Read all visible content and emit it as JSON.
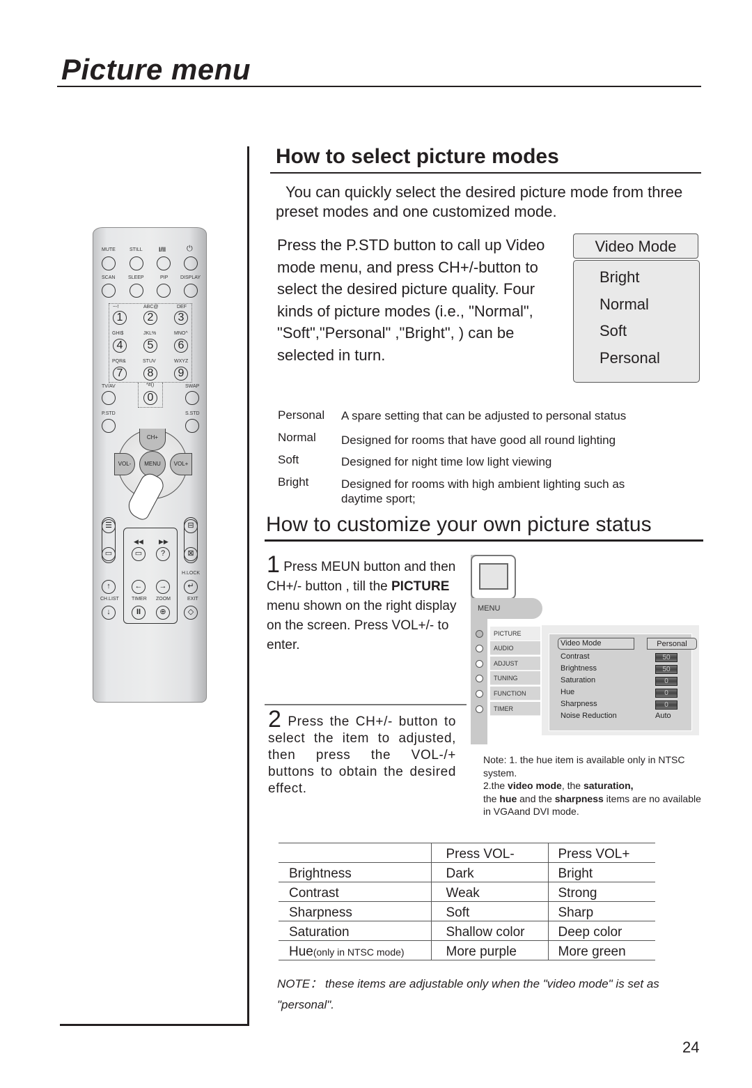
{
  "page": {
    "title": "Picture menu",
    "page_number": "24"
  },
  "remote": {
    "row1": [
      "MUTE",
      "STILL",
      "I/II",
      "power-icon"
    ],
    "row2": [
      "SCAN",
      "SLEEP",
      "PIP",
      "DISPLAY"
    ],
    "numbers": [
      {
        "num": "1",
        "letters": "~-!"
      },
      {
        "num": "2",
        "letters": "ABC@"
      },
      {
        "num": "3",
        "letters": "DEF"
      },
      {
        "num": "4",
        "letters": "GHI$"
      },
      {
        "num": "5",
        "letters": "JKL%"
      },
      {
        "num": "6",
        "letters": "MNO^"
      },
      {
        "num": "7",
        "letters": "PQR&"
      },
      {
        "num": "8",
        "letters": "STUV"
      },
      {
        "num": "9",
        "letters": "WXYZ"
      },
      {
        "num": "0",
        "letters": "*#()"
      }
    ],
    "tv_av": "TV/AV",
    "swap": "SWAP",
    "p_std": "P.STD",
    "s_std": "S.STD",
    "ch_plus": "CH+",
    "vol_minus": "VOL-",
    "menu": "MENU",
    "vol_plus": "VOL+",
    "h_lock": "H.LOCK",
    "ch_list": "CH.LIST",
    "timer": "TIMER",
    "zoom": "ZOOM",
    "exit": "EXIT"
  },
  "section1": {
    "heading": "How to select picture modes",
    "intro": "You can quickly select the desired picture mode from three preset modes and one customized mode.",
    "instructions": "Press the P.STD  button to call up Video mode menu, and press CH+/-button to select the desired picture quality. Four  kinds of picture modes (i.e., \"Normal\", \"Soft\",\"Personal\" ,\"Bright\", ) can be selected in turn.",
    "video_mode_menu": {
      "header": "Video Mode",
      "options": [
        "Bright",
        "Normal",
        "Soft",
        "Personal"
      ]
    },
    "modes": [
      {
        "name": "Personal",
        "desc": "A spare setting that can be adjusted to personal status"
      },
      {
        "name": "Normal",
        "desc": "Designed for rooms that have good all round lighting"
      },
      {
        "name": "Soft",
        "desc": "Designed for night time low light viewing"
      },
      {
        "name": "Bright",
        "desc": "Designed for rooms with high ambient lighting such as daytime sport;"
      }
    ]
  },
  "section2": {
    "heading": "How to customize your own picture status",
    "step1": {
      "num": "1",
      "pre": " Press MEUN button and then CH+/- button , till the ",
      "bold": "PICTURE",
      "post": " menu shown on the right display on the screen. Press VOL+/- to enter."
    },
    "step2": {
      "num": "2",
      "text": " Press the CH+/- button to select the item to adjusted, then press the VOL-/+ buttons to obtain the desired effect."
    },
    "osd": {
      "menu_label": "MENU",
      "items": [
        "PICTURE",
        "AUDIO",
        "ADJUST",
        "TUNING",
        "FUNCTION",
        "TIMER"
      ],
      "active_item": "PICTURE",
      "video_mode_label": "Video Mode",
      "video_mode_value": "Personal",
      "settings": [
        {
          "label": "Contrast",
          "value": "50"
        },
        {
          "label": "Brightness",
          "value": "50"
        },
        {
          "label": "Saturation",
          "value": "0"
        },
        {
          "label": "Hue",
          "value": "0"
        },
        {
          "label": "Sharpness",
          "value": "0"
        }
      ],
      "noise_label": "Noise Reduction",
      "noise_value": "Auto"
    },
    "note": {
      "line1": "Note: 1. the hue item is available only in NTSC system.",
      "l2_a": "2.the ",
      "l2_b": "video mode",
      "l2_c": ", the ",
      "l2_d": "saturation,",
      "l3_a": "the ",
      "l3_b": "hue",
      "l3_c": " and the ",
      "l3_d": "sharpness",
      "l3_e": " items are no available in VGAand DVI mode."
    },
    "table": {
      "headers": [
        "",
        "Press VOL-",
        "Press VOL+"
      ],
      "rows": [
        [
          "Brightness",
          "Dark",
          "Bright"
        ],
        [
          "Contrast",
          "Weak",
          "Strong"
        ],
        [
          "Sharpness",
          "Soft",
          "Sharp"
        ],
        [
          "Saturation",
          "Shallow color",
          "Deep color"
        ]
      ],
      "hue_row": {
        "label": "Hue",
        "qualifier": "(only in NTSC mode)",
        "minus": "More purple",
        "plus": "More green"
      }
    },
    "footnote": "NOTE： these items are adjustable only when the \"video mode\" is set as \"personal\"."
  }
}
